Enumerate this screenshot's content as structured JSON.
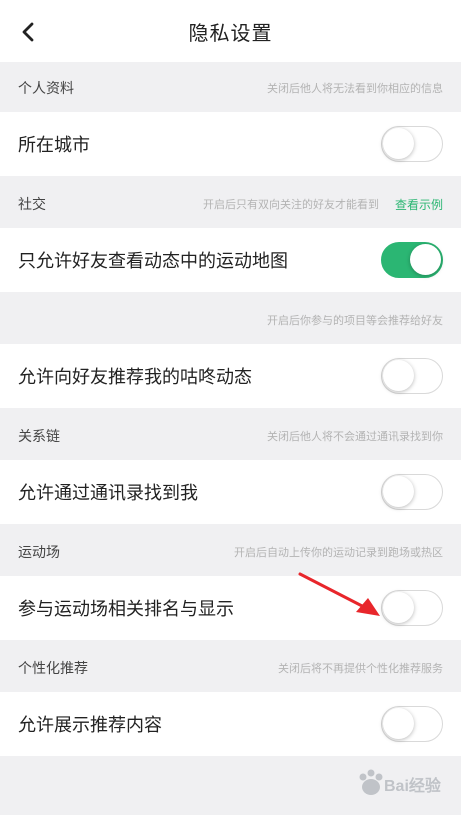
{
  "header": {
    "title": "隐私设置",
    "back_icon": "chevron-left-icon"
  },
  "sections": [
    {
      "title": "个人资料",
      "hint": "关闭后他人将无法看到你相应的信息",
      "rows": [
        {
          "label": "所在城市",
          "enabled": false
        }
      ]
    },
    {
      "title": "社交",
      "hint": "开启后只有双向关注的好友才能看到",
      "link": "查看示例",
      "rows": [
        {
          "label": "只允许好友查看动态中的运动地图",
          "enabled": true
        }
      ]
    },
    {
      "title": "",
      "hint": "开启后你参与的项目等会推荐给好友",
      "rows": [
        {
          "label": "允许向好友推荐我的咕咚动态",
          "enabled": false
        }
      ]
    },
    {
      "title": "关系链",
      "hint": "关闭后他人将不会通过通讯录找到你",
      "rows": [
        {
          "label": "允许通过通讯录找到我",
          "enabled": false
        }
      ]
    },
    {
      "title": "运动场",
      "hint": "开启后自动上传你的运动记录到跑场或热区",
      "rows": [
        {
          "label": "参与运动场相关排名与显示",
          "enabled": false
        }
      ]
    },
    {
      "title": "个性化推荐",
      "hint": "关闭后将不再提供个性化推荐服务",
      "rows": [
        {
          "label": "允许展示推荐内容",
          "enabled": false
        }
      ]
    }
  ],
  "colors": {
    "accent": "#2bb673",
    "annotation_arrow": "#e8262b",
    "background": "#f0f0f2"
  },
  "watermark": {
    "text": "Bai经验"
  }
}
